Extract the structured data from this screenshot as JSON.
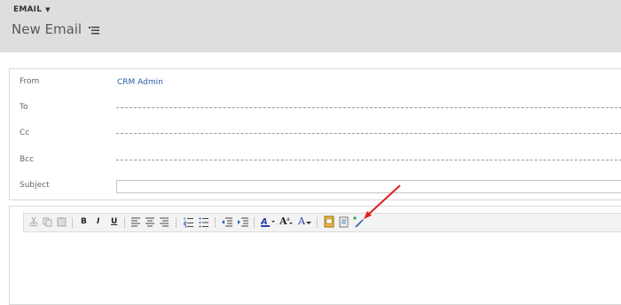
{
  "header": {
    "entity_label": "EMAIL",
    "page_title": "New Email"
  },
  "form": {
    "from_label": "From",
    "from_value": "CRM Admin",
    "to_label": "To",
    "cc_label": "Cc",
    "bcc_label": "Bcc",
    "subject_label": "Subject",
    "subject_value": ""
  },
  "toolbar": {
    "bold_label": "B",
    "italic_label": "I",
    "underline_label": "U",
    "grow_font_label": "A",
    "font_color_label": "A"
  },
  "colors": {
    "header_bg": "#dedede",
    "link_blue": "#2a5fa8",
    "annotation_red": "#e02020"
  }
}
